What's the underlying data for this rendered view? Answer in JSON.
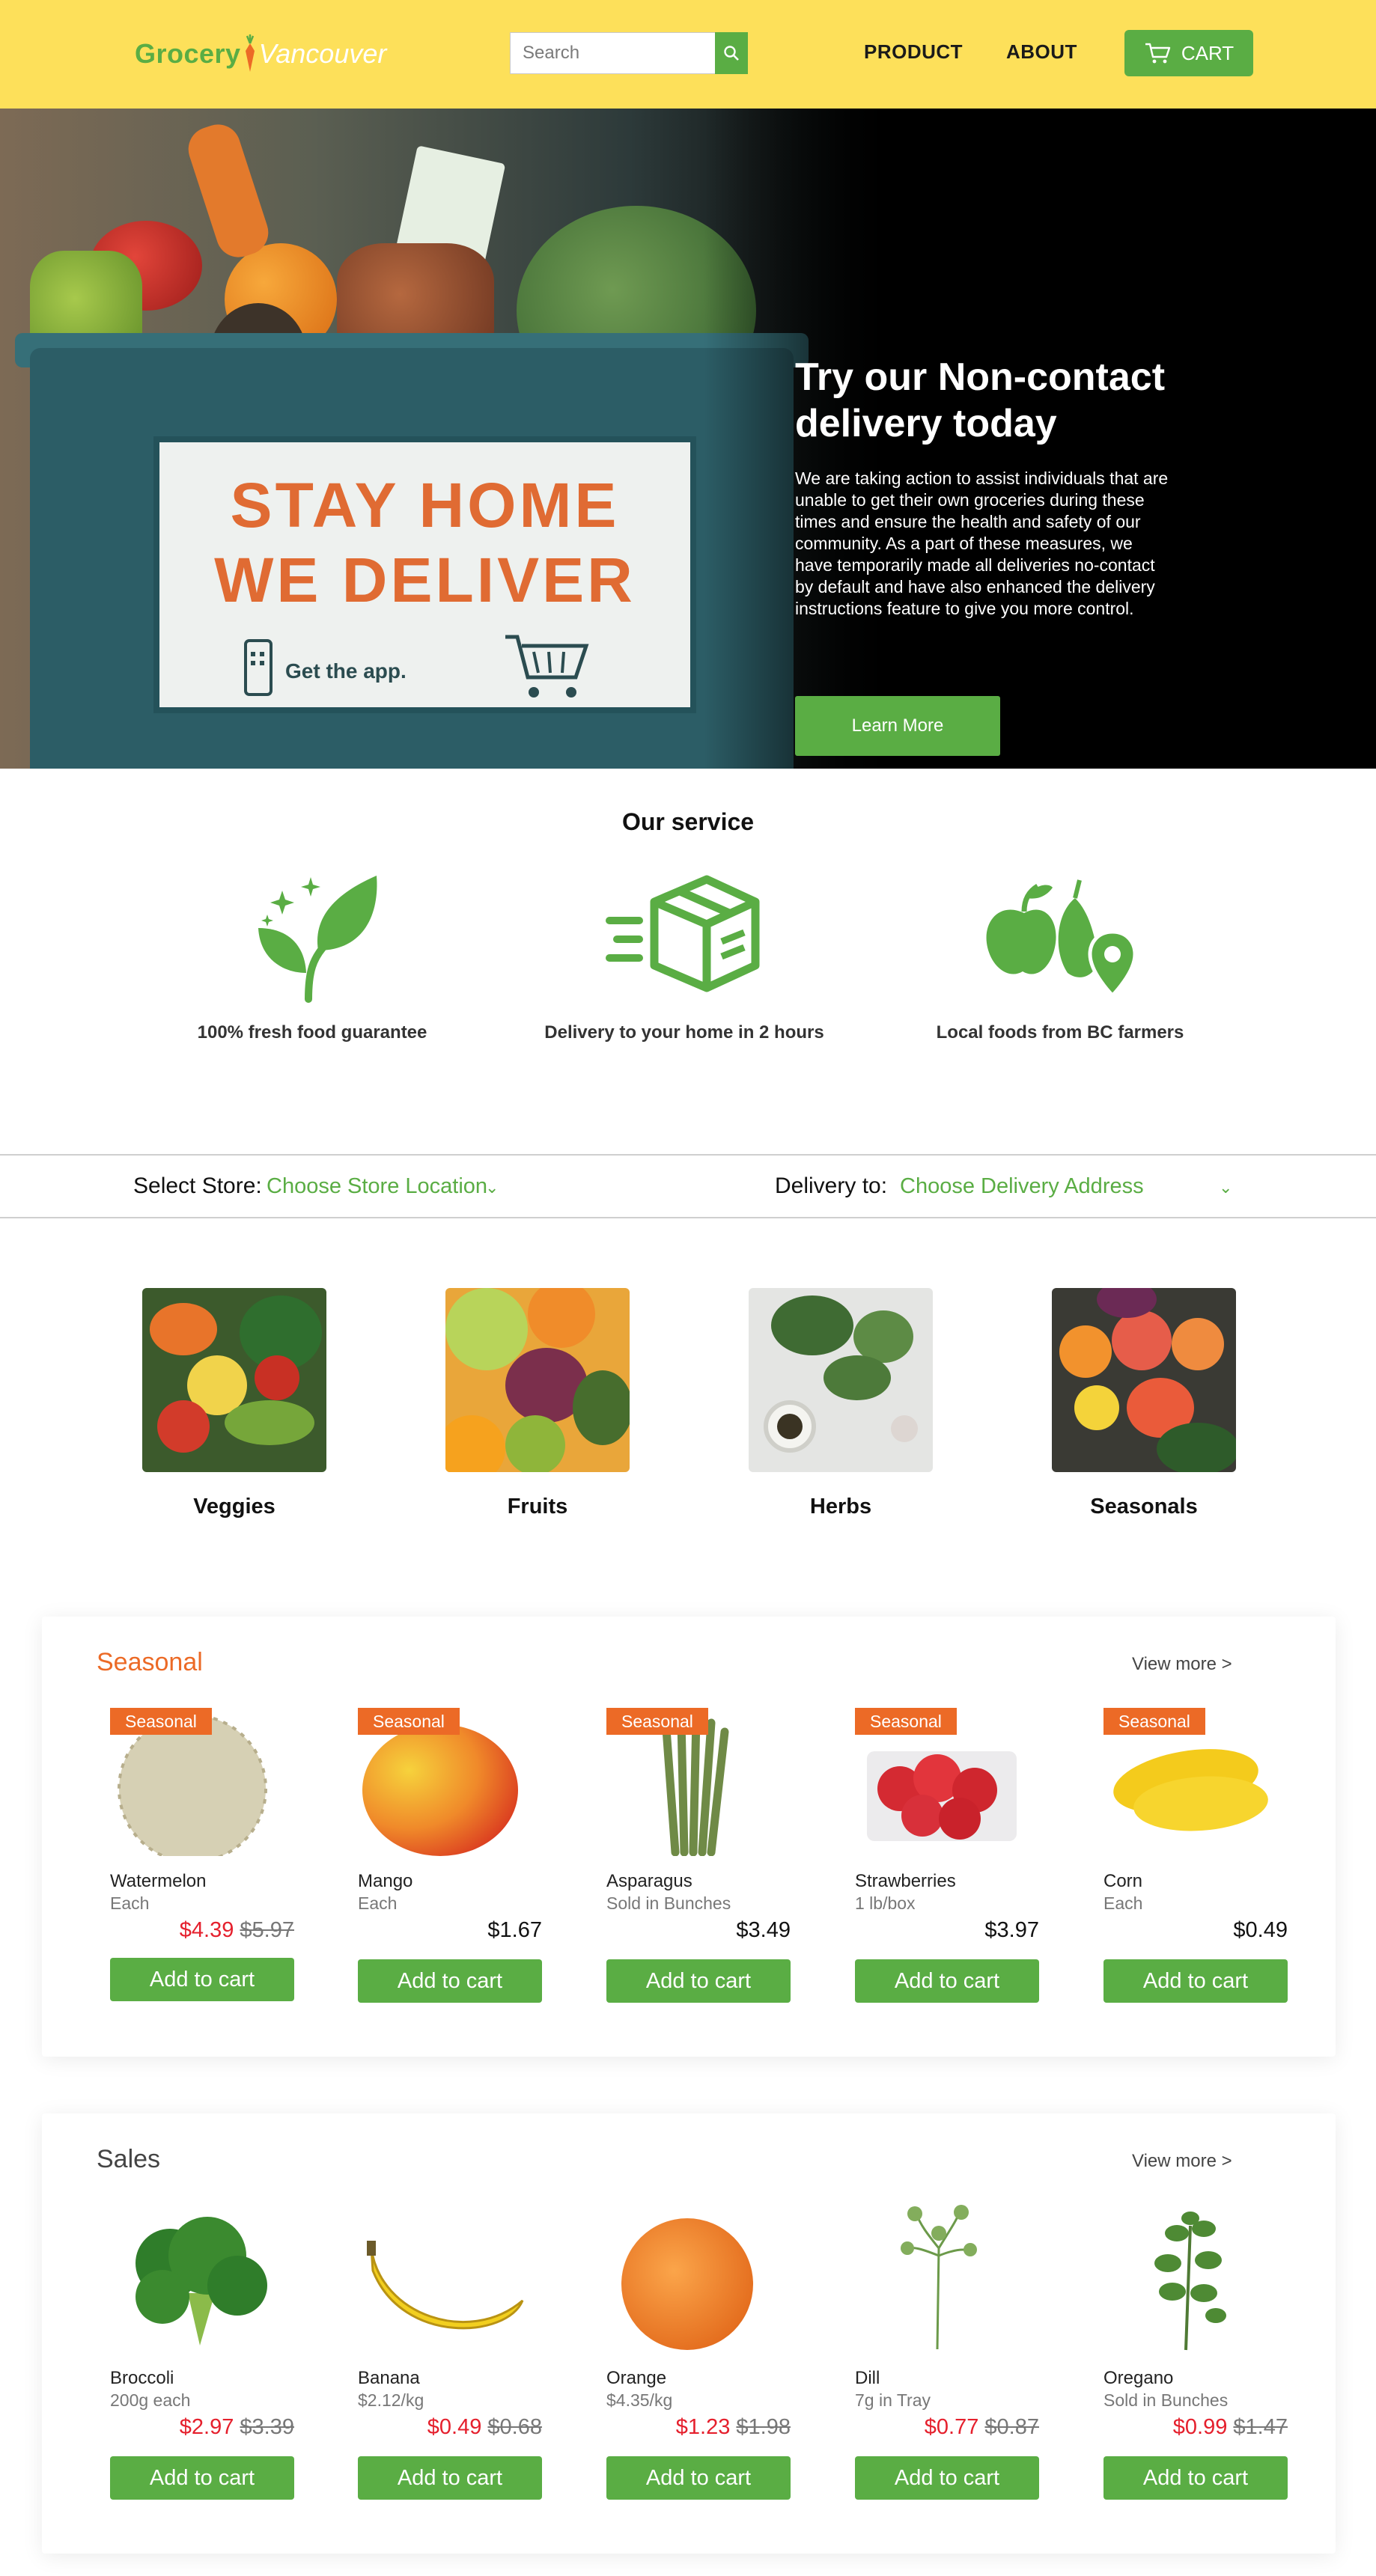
{
  "header": {
    "logo_grocery": "Grocery",
    "logo_vancouver": "Vancouver",
    "search_placeholder": "Search",
    "nav": {
      "product": "PRODUCT",
      "about": "ABOUT"
    },
    "cart_label": "CART",
    "colors": {
      "header_bg": "#fde05a",
      "accent_green": "#5aad44"
    }
  },
  "hero": {
    "sign_line1": "STAY HOME",
    "sign_line2": "WE DELIVER",
    "sign_app": "Get the app.",
    "title": "Try our Non-contact delivery today",
    "text": "We are taking action to assist individuals that are unable to get their own groceries during these times and ensure the health and safety of our community. As a part of these measures, we have temporarily made all deliveries no-contact by default and have also enhanced the delivery instructions feature to give you more control.",
    "button": "Learn More"
  },
  "services": {
    "title": "Our service",
    "items": [
      {
        "icon": "fresh-leaf-icon",
        "label": "100% fresh food guarantee"
      },
      {
        "icon": "delivery-box-icon",
        "label": "Delivery to your home in 2 hours"
      },
      {
        "icon": "local-produce-pin-icon",
        "label": "Local foods from BC farmers"
      }
    ]
  },
  "store_bar": {
    "store_label": "Select Store:",
    "store_value": "Choose Store Location",
    "delivery_label": "Delivery to:",
    "delivery_value": "Choose Delivery Address"
  },
  "categories": [
    {
      "label": "Veggies"
    },
    {
      "label": "Fruits"
    },
    {
      "label": "Herbs"
    },
    {
      "label": "Seasonals"
    }
  ],
  "seasonal": {
    "title": "Seasonal",
    "view_more": "View more >",
    "badge": "Seasonal",
    "products": [
      {
        "name": "Watermelon",
        "unit": "Each",
        "price": "$4.39",
        "was": "$5.97",
        "button": "Add to cart"
      },
      {
        "name": "Mango",
        "unit": "Each",
        "price": "$1.67",
        "was": "",
        "button": "Add to cart"
      },
      {
        "name": "Asparagus",
        "unit": "Sold in Bunches",
        "price": "$3.49",
        "was": "",
        "button": "Add to cart"
      },
      {
        "name": "Strawberries",
        "unit": "1 lb/box",
        "price": "$3.97",
        "was": "",
        "button": "Add to cart"
      },
      {
        "name": "Corn",
        "unit": "Each",
        "price": "$0.49",
        "was": "",
        "button": "Add to cart"
      }
    ]
  },
  "sales": {
    "title": "Sales",
    "view_more": "View more >",
    "products": [
      {
        "name": "Broccoli",
        "unit": "200g each",
        "price": "$2.97",
        "was": "$3.39",
        "button": "Add to cart"
      },
      {
        "name": "Banana",
        "unit": "$2.12/kg",
        "price": "$0.49",
        "was": "$0.68",
        "button": "Add to cart"
      },
      {
        "name": "Orange",
        "unit": "$4.35/kg",
        "price": "$1.23",
        "was": "$1.98",
        "button": "Add to cart"
      },
      {
        "name": "Dill",
        "unit": "7g in Tray",
        "price": "$0.77",
        "was": "$0.87",
        "button": "Add to cart"
      },
      {
        "name": "Oregano",
        "unit": "Sold in Bunches",
        "price": "$0.99",
        "was": "$1.47",
        "button": "Add to cart"
      }
    ]
  }
}
